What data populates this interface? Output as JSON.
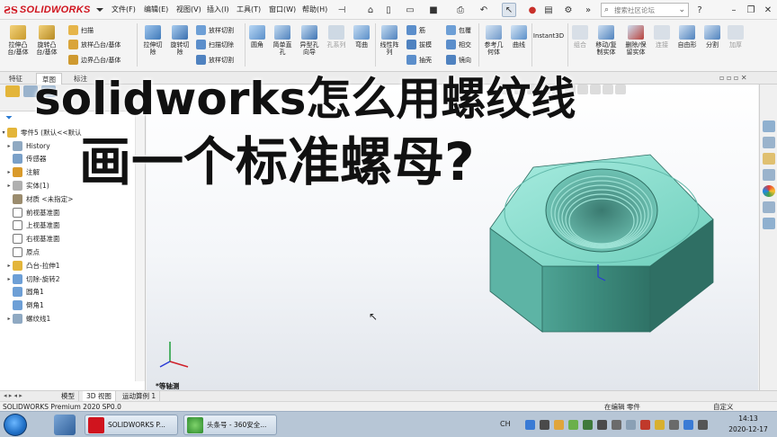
{
  "app": {
    "brand": "SOLIDWORKS",
    "menus": [
      "文件(F)",
      "编辑(E)",
      "视图(V)",
      "插入(I)",
      "工具(T)",
      "窗口(W)",
      "帮助(H)"
    ],
    "search_placeholder": "搜索社区论坛"
  },
  "command_manager": {
    "large_tools": [
      {
        "label": "拉伸凸\n台/基体",
        "icon": "extruded-boss-icon"
      },
      {
        "label": "旋转凸\n台/基体",
        "icon": "revolved-boss-icon"
      },
      {
        "label": "拉伸切\n除",
        "icon": "extruded-cut-icon"
      },
      {
        "label": "旋转切\n除",
        "icon": "revolved-cut-icon"
      },
      {
        "label": "圆角",
        "icon": "fillet-icon"
      },
      {
        "label": "简单直\n孔",
        "icon": "simple-hole-icon"
      },
      {
        "label": "异型孔\n向导",
        "icon": "hole-wizard-icon"
      },
      {
        "label": "孔系列",
        "icon": "hole-series-icon"
      },
      {
        "label": "弯曲",
        "icon": "flex-icon"
      },
      {
        "label": "线性阵\n列",
        "icon": "linear-pattern-icon"
      },
      {
        "label": "参考几\n何体",
        "icon": "reference-geometry-icon"
      },
      {
        "label": "曲线",
        "icon": "curves-icon"
      },
      {
        "label": "Instant3D",
        "icon": "instant3d-icon"
      },
      {
        "label": "组合",
        "icon": "combine-icon"
      },
      {
        "label": "移动/复\n制实体",
        "icon": "move-copy-body-icon"
      },
      {
        "label": "删除/保\n留实体",
        "icon": "delete-keep-body-icon"
      },
      {
        "label": "连接",
        "icon": "join-icon"
      },
      {
        "label": "自由形",
        "icon": "freeform-icon"
      },
      {
        "label": "分割",
        "icon": "split-icon"
      },
      {
        "label": "加厚",
        "icon": "thicken-icon"
      }
    ],
    "small_tools": [
      {
        "label": "扫描",
        "icon": "swept-boss-icon"
      },
      {
        "label": "放样凸台/基体",
        "icon": "lofted-boss-icon"
      },
      {
        "label": "边界凸台/基体",
        "icon": "boundary-boss-icon"
      },
      {
        "label": "放样切割",
        "icon": "lofted-cut-icon"
      },
      {
        "label": "扫描切除",
        "icon": "swept-cut-icon"
      },
      {
        "label": "放样切割",
        "icon": "lofted-cut-2-icon"
      },
      {
        "label": "筋",
        "icon": "rib-icon"
      },
      {
        "label": "拔模",
        "icon": "draft-icon"
      },
      {
        "label": "抽壳",
        "icon": "shell-icon"
      },
      {
        "label": "包覆",
        "icon": "wrap-icon"
      },
      {
        "label": "相交",
        "icon": "intersect-icon"
      },
      {
        "label": "镜向",
        "icon": "mirror-icon"
      }
    ],
    "tabs": [
      "特征",
      "草图",
      "标注"
    ]
  },
  "feature_tree": {
    "root": "零件5 (默认<<默认",
    "items": [
      {
        "label": "History",
        "icon": "history-icon",
        "expand": "▸"
      },
      {
        "label": "传感器",
        "icon": "sensor-icon",
        "expand": ""
      },
      {
        "label": "注解",
        "icon": "annotations-icon",
        "expand": "▸"
      },
      {
        "label": "实体(1)",
        "icon": "solid-bodies-icon",
        "expand": "▸"
      },
      {
        "label": "材质 <未指定>",
        "icon": "material-icon",
        "expand": ""
      },
      {
        "label": "前视基准面",
        "icon": "plane-icon",
        "expand": ""
      },
      {
        "label": "上视基准面",
        "icon": "plane-icon",
        "expand": ""
      },
      {
        "label": "右视基准面",
        "icon": "plane-icon",
        "expand": ""
      },
      {
        "label": "原点",
        "icon": "origin-icon",
        "expand": ""
      },
      {
        "label": "凸台-拉伸1",
        "icon": "boss-extrude-icon",
        "expand": "▸"
      },
      {
        "label": "切除-旋转2",
        "icon": "cut-revolve-icon",
        "expand": "▸"
      },
      {
        "label": "圆角1",
        "icon": "fillet-feature-icon",
        "expand": ""
      },
      {
        "label": "倒角1",
        "icon": "chamfer-feature-icon",
        "expand": ""
      },
      {
        "label": "螺纹线1",
        "icon": "thread-feature-icon",
        "expand": "▸"
      }
    ]
  },
  "overlay": {
    "line1": "solidworks怎么用螺纹线",
    "line2": "画一个标准螺母?"
  },
  "viewport": {
    "view_label": "*等轴测"
  },
  "bottom_tabs": [
    "模型",
    "3D 视图",
    "运动算例 1"
  ],
  "status": {
    "left": "SOLIDWORKS Premium 2020 SP0.0",
    "editing": "在编辑 零件",
    "custom": "自定义"
  },
  "taskbar": {
    "tasks": [
      {
        "label": "SOLIDWORKS P...",
        "icon": "solidworks-task-icon"
      },
      {
        "label": "头条号 - 360安全...",
        "icon": "browser-task-icon"
      }
    ],
    "ime": "CH",
    "time": "14:13",
    "date": "2020-12-17"
  },
  "colors": {
    "brand_red": "#d0141e",
    "nut_face": "#7fd9c6",
    "nut_side": "#3f8e80",
    "taskbar": "#b7c6d6"
  }
}
